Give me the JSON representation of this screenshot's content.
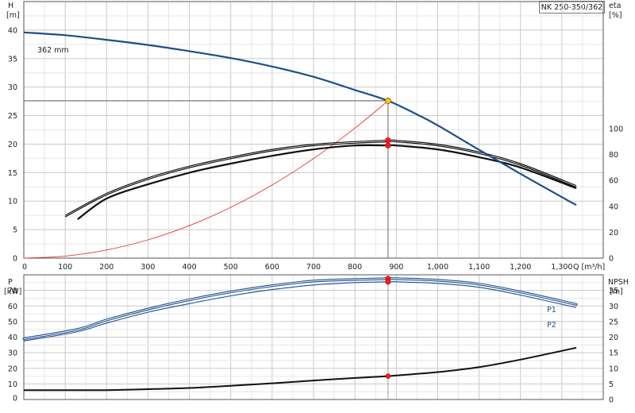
{
  "chart_data": [
    {
      "type": "line",
      "title": "NK 250-350/362",
      "xlabel": "Q [m³/h]",
      "ylabel_left": "H\n[m]",
      "ylabel_right": "eta\n[%]",
      "xlim": [
        0,
        1400
      ],
      "ylim_left": [
        0,
        45
      ],
      "ylim_right": [
        0,
        0
      ],
      "x_ticks": [
        0,
        100,
        200,
        300,
        400,
        500,
        600,
        700,
        800,
        900,
        1000,
        1100,
        1200,
        1300
      ],
      "x_tick_labels": [
        "0",
        "100",
        "200",
        "300",
        "400",
        "500",
        "600",
        "700",
        "800",
        "900",
        "1,000",
        "1,100",
        "1,200",
        "1,300"
      ],
      "y_left_ticks": [
        0,
        5,
        10,
        15,
        20,
        25,
        30,
        35,
        40
      ],
      "y_right_ticks": [
        0,
        20,
        40,
        60,
        80,
        100
      ],
      "grid": true,
      "annotations": [
        {
          "text": "362 mm",
          "x": 60,
          "y": 40
        }
      ],
      "duty_point": {
        "Q": 880,
        "H": 27.6
      },
      "series": [
        {
          "key": "head",
          "axis": "left",
          "color": "#1b4f8a",
          "x": [
            0,
            100,
            200,
            300,
            400,
            500,
            600,
            700,
            800,
            880,
            950,
            1000,
            1100,
            1200,
            1300,
            1335
          ],
          "y": [
            39.6,
            39.1,
            38.3,
            37.4,
            36.3,
            35.1,
            33.6,
            31.8,
            29.5,
            27.6,
            25.2,
            23.3,
            19.0,
            14.8,
            10.7,
            9.3
          ]
        },
        {
          "key": "system",
          "axis": "left",
          "color": "#e83030",
          "x": [
            0,
            100,
            200,
            300,
            400,
            500,
            600,
            700,
            800,
            880
          ],
          "y": [
            0.0,
            0.36,
            1.43,
            3.21,
            5.7,
            8.91,
            12.83,
            17.47,
            22.81,
            27.6
          ]
        },
        {
          "key": "eta_upper",
          "axis": "right",
          "color": "#111111",
          "x": [
            100,
            200,
            300,
            400,
            500,
            600,
            700,
            800,
            880,
            900,
            1000,
            1100,
            1200,
            1335
          ],
          "y": [
            33,
            50,
            62,
            71,
            78,
            84,
            88,
            90,
            91,
            91,
            88,
            82,
            73,
            56
          ]
        },
        {
          "key": "eta_lower",
          "axis": "right",
          "color": "#111111",
          "x": [
            130,
            200,
            300,
            400,
            500,
            600,
            700,
            800,
            880,
            900,
            1000,
            1100,
            1200,
            1335
          ],
          "y": [
            30,
            46,
            57,
            66,
            73,
            79,
            84,
            87,
            87,
            87,
            84,
            78,
            70,
            54
          ]
        }
      ],
      "eta_points": [
        91,
        87
      ]
    },
    {
      "type": "line",
      "xlabel": "",
      "ylabel_left": "P\n[kW]",
      "ylabel_right": "NPSH\n[m]",
      "xlim": [
        0,
        1400
      ],
      "ylim_left": [
        0,
        80
      ],
      "ylim_right": [
        0,
        40
      ],
      "y_left_ticks": [
        0,
        10,
        20,
        30,
        40,
        50,
        60,
        70
      ],
      "y_left_tick_labels": [
        "0",
        "10",
        "20",
        "30",
        "40",
        "50",
        "60",
        "70"
      ],
      "y_right_ticks": [
        0,
        5,
        10,
        15,
        20,
        25,
        30,
        35
      ],
      "grid": true,
      "series": [
        {
          "key": "P1",
          "name": "P1",
          "axis": "left",
          "color": "#1b4f8a",
          "x": [
            0,
            130,
            200,
            300,
            400,
            500,
            600,
            700,
            800,
            880,
            900,
            1000,
            1100,
            1200,
            1335
          ],
          "y": [
            39,
            45,
            51,
            58,
            64,
            69,
            73,
            76,
            77,
            77.5,
            77.5,
            76.5,
            74,
            69,
            61
          ]
        },
        {
          "key": "P2",
          "name": "P2",
          "axis": "left",
          "color": "#1b4f8a",
          "x": [
            0,
            130,
            200,
            300,
            400,
            500,
            600,
            700,
            800,
            880,
            900,
            1000,
            1100,
            1200,
            1335
          ],
          "y": [
            37.5,
            43.5,
            49,
            56,
            61.5,
            66.5,
            70.5,
            73.5,
            75,
            75.5,
            75.5,
            74.5,
            72,
            67,
            59
          ]
        },
        {
          "key": "NPSH",
          "axis": "right",
          "color": "#111111",
          "x": [
            0,
            130,
            200,
            300,
            400,
            500,
            600,
            700,
            800,
            880,
            900,
            1000,
            1100,
            1200,
            1335
          ],
          "y": [
            3.0,
            3.0,
            3.0,
            3.3,
            3.7,
            4.4,
            5.2,
            6.1,
            6.9,
            7.5,
            7.7,
            8.8,
            10.4,
            12.8,
            16.6
          ]
        }
      ],
      "duty_P": [
        77.5,
        75.5
      ],
      "duty_NPSH": 7.5
    }
  ]
}
